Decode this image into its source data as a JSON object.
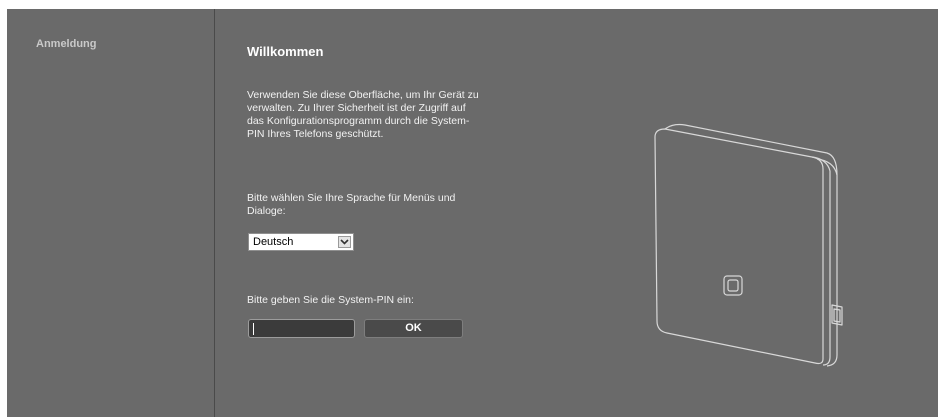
{
  "sidebar": {
    "items": [
      {
        "label": "Anmeldung"
      }
    ]
  },
  "main": {
    "title": "Willkommen",
    "intro": "Verwenden Sie diese Oberfläche, um Ihr Gerät zu verwalten. Zu Ihrer Sicherheit ist der Zugriff auf das Konfigurationsprogramm durch die System-PIN Ihres Telefons geschützt.",
    "language_prompt": "Bitte wählen Sie Ihre Sprache für Menüs und Dialoge:",
    "language_select": {
      "value": "Deutsch",
      "icon": "chevron-down-icon"
    },
    "pin_prompt": "Bitte geben Sie die System-PIN ein:",
    "pin_input": {
      "value": ""
    },
    "ok_label": "OK"
  },
  "colors": {
    "background": "#6a6a6a",
    "title": "#ffffff",
    "sidebar_text": "#c9c9c9",
    "input_dark": "#3b3b3b",
    "button": "#4a4a4a"
  }
}
